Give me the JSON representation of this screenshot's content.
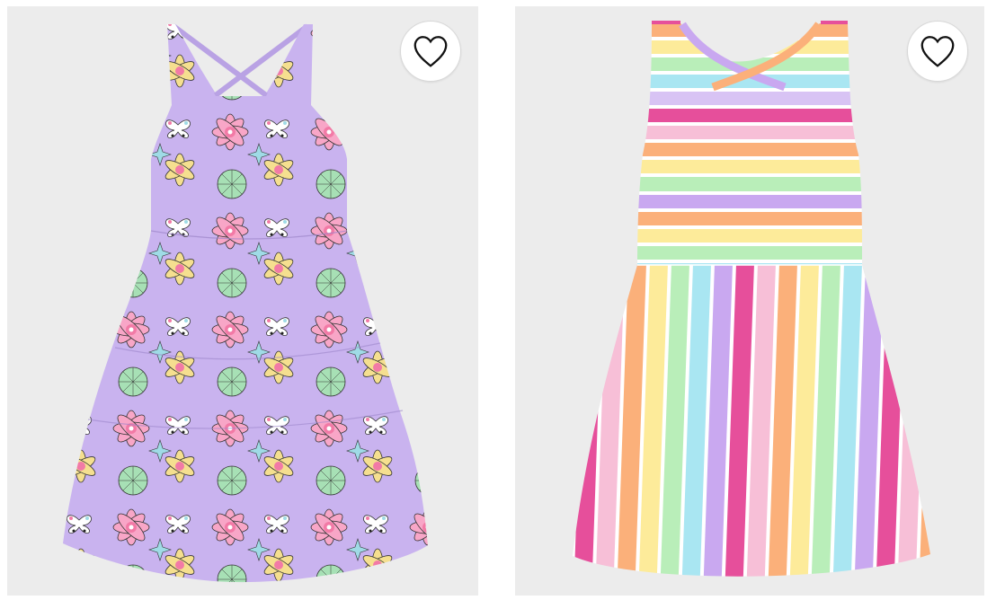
{
  "products": [
    {
      "image_alt": "",
      "icon": "heart-outline-icon",
      "palette": {
        "base": "#c9b3ef",
        "petals": [
          "#f8a6c7",
          "#f5df8f",
          "#a7e0b5",
          "#9fdbe6",
          "#f27aa6"
        ],
        "outline": "#333333"
      }
    },
    {
      "image_alt": "",
      "icon": "heart-outline-icon",
      "palette": {
        "stripes": [
          "#c9a8f0",
          "#e64f9b",
          "#f7bfd7",
          "#fbb07a",
          "#fdeb9a",
          "#b9eeb9",
          "#a9e6f2",
          "#ffffff"
        ]
      }
    }
  ]
}
